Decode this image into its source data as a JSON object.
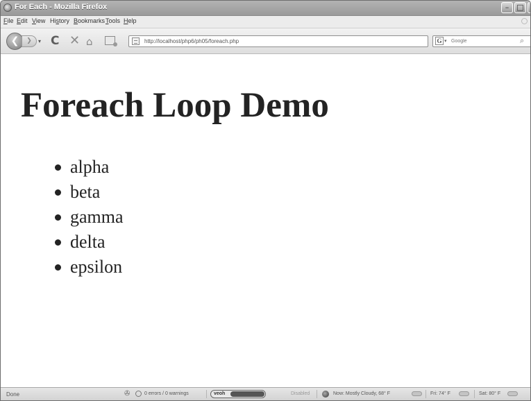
{
  "window": {
    "title": "For Each - Mozilla Firefox",
    "min_glyph": "–",
    "max_glyph": "□",
    "close_glyph": "✕"
  },
  "menu": {
    "items": [
      {
        "accel": "F",
        "rest": "ile"
      },
      {
        "accel": "E",
        "rest": "dit"
      },
      {
        "accel": "V",
        "rest": "iew"
      },
      {
        "accel": "",
        "rest": "Hi",
        "accel2": "s",
        "rest2": "tory"
      },
      {
        "accel": "B",
        "rest": "ookmarks"
      },
      {
        "accel": "T",
        "rest": "ools"
      },
      {
        "accel": "H",
        "rest": "elp"
      }
    ]
  },
  "nav": {
    "back_glyph": "❮",
    "forward_glyph": "❯",
    "history_drop_glyph": "▾",
    "reload_glyph": "C",
    "stop_glyph": "✕",
    "home_glyph": "⌂",
    "url": "http://localhost/php6/ph05/foreach.php",
    "star_glyph": "☆",
    "url_drop_glyph": "▾",
    "search_engine_glyph": "G",
    "search_drop_glyph": "▾",
    "search_placeholder": "Google",
    "search_go_glyph": "⌕"
  },
  "page": {
    "heading": "Foreach Loop Demo",
    "items": [
      "alpha",
      "beta",
      "gamma",
      "delta",
      "epsilon"
    ]
  },
  "status": {
    "text": "Done",
    "errors": "0 errors / 0 warnings",
    "addon_label": "veoh",
    "disabled_label": "Disabled",
    "weather_now": "Now: Mostly Cloudy, 68° F",
    "weather_fri": "Fri: 74° F",
    "weather_sat": "Sat: 80° F",
    "tool_glyph": "✇"
  },
  "icons": {
    "title_icon": "firefox-icon",
    "bookmark_icon": "bookmark-page-icon",
    "favicon": "page-favicon-icon"
  }
}
